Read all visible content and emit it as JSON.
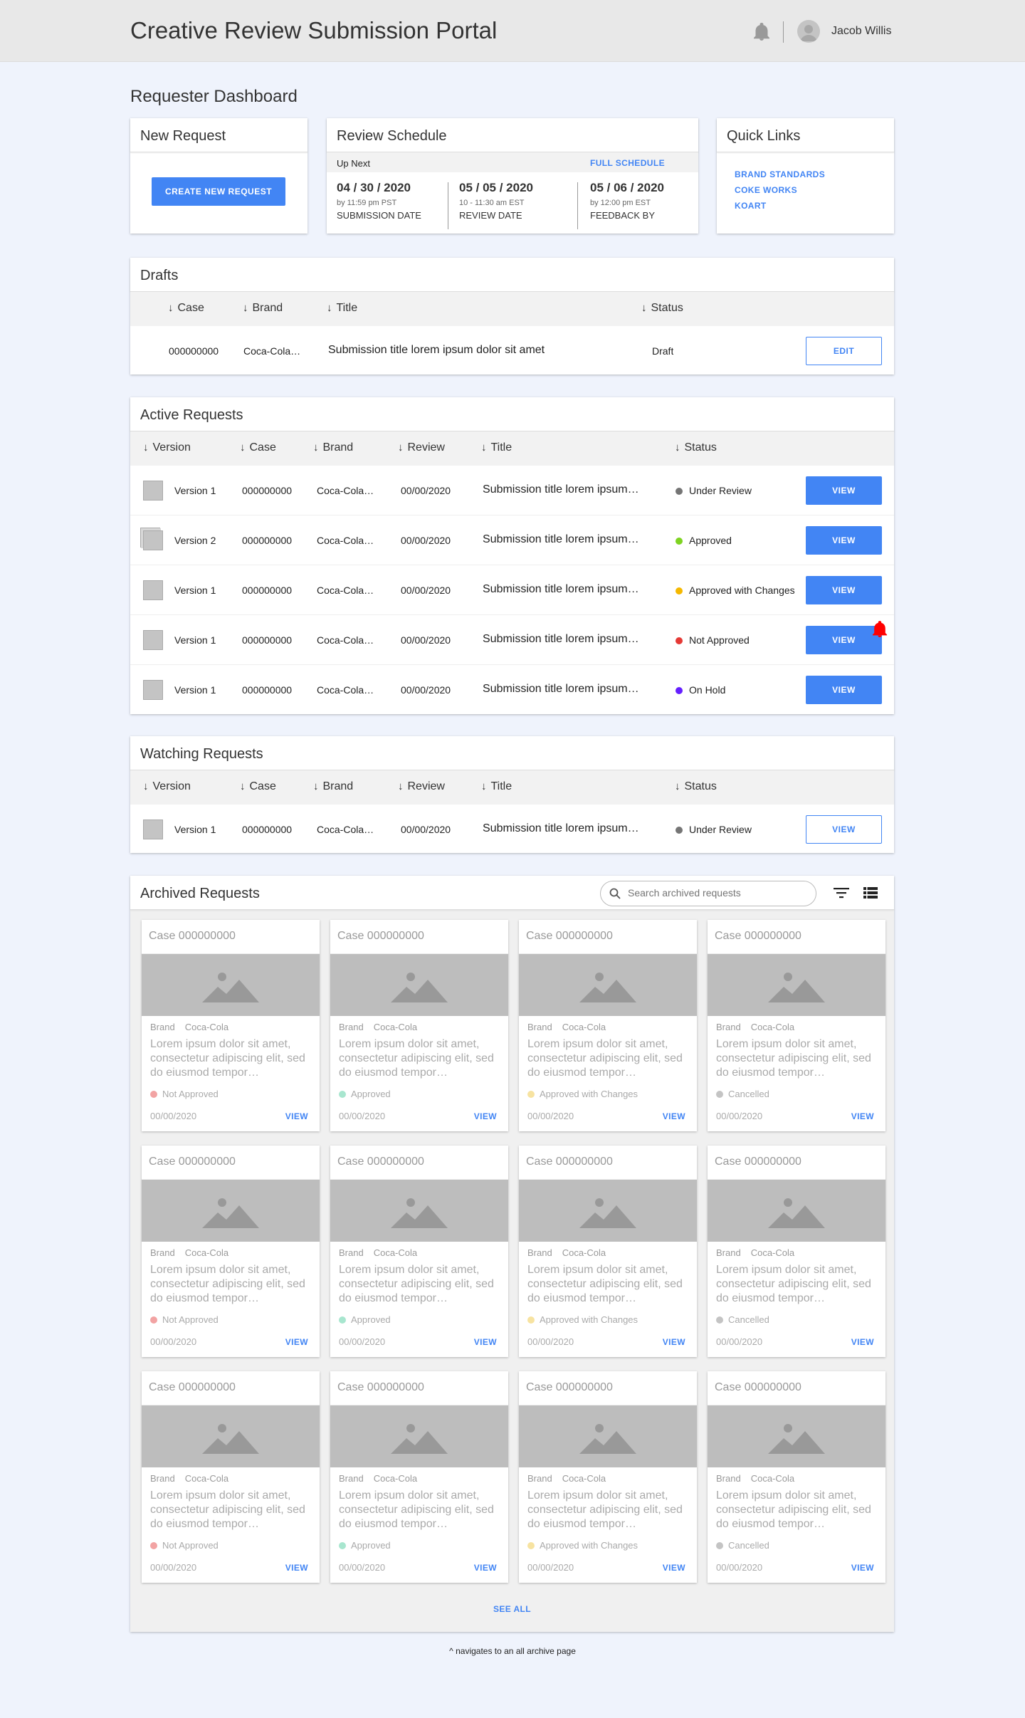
{
  "header": {
    "app_title": "Creative Review Submission Portal",
    "user_name": "Jacob Willis"
  },
  "page_title": "Requester Dashboard",
  "new_request": {
    "title": "New Request",
    "button_label": "CREATE NEW REQUEST"
  },
  "review_schedule": {
    "title": "Review Schedule",
    "up_next": "Up Next",
    "full_schedule_link": "FULL SCHEDULE",
    "items": [
      {
        "date": "04 / 30 / 2020",
        "sub": "by 11:59 pm PST",
        "label": "SUBMISSION DATE"
      },
      {
        "date": "05 / 05 / 2020",
        "sub": "10 - 11:30 am EST",
        "label": "REVIEW DATE"
      },
      {
        "date": "05 / 06 / 2020",
        "sub": "by 12:00 pm EST",
        "label": "FEEDBACK BY"
      }
    ]
  },
  "quick_links": {
    "title": "Quick Links",
    "links": [
      "BRAND STANDARDS",
      "COKE WORKS",
      "KOART"
    ]
  },
  "drafts": {
    "title": "Drafts",
    "columns": [
      "Case",
      "Brand",
      "Title",
      "Status"
    ],
    "rows": [
      {
        "case": "000000000",
        "brand": "Coca-Cola…",
        "title": "Submission title lorem ipsum dolor sit amet",
        "status": "Draft",
        "action": "EDIT"
      }
    ]
  },
  "active_requests": {
    "title": "Active Requests",
    "columns": [
      "Version",
      "Case",
      "Brand",
      "Review",
      "Title",
      "Status"
    ],
    "rows": [
      {
        "version": "Version 1",
        "case": "000000000",
        "brand": "Coca-Cola…",
        "review": "00/00/2020",
        "title": "Submission title lorem ipsum…",
        "status": "Under Review",
        "status_color": "#757575",
        "action": "VIEW"
      },
      {
        "version": "Version 2",
        "case": "000000000",
        "brand": "Coca-Cola…",
        "review": "00/00/2020",
        "title": "Submission title lorem ipsum…",
        "status": "Approved",
        "status_color": "#7ed321",
        "action": "VIEW"
      },
      {
        "version": "Version 1",
        "case": "000000000",
        "brand": "Coca-Cola…",
        "review": "00/00/2020",
        "title": "Submission title lorem ipsum…",
        "status": "Approved with Changes",
        "status_color": "#f5b800",
        "action": "VIEW"
      },
      {
        "version": "Version 1",
        "case": "000000000",
        "brand": "Coca-Cola…",
        "review": "00/00/2020",
        "title": "Submission title lorem ipsum…",
        "status": "Not Approved",
        "status_color": "#e53935",
        "action": "VIEW"
      },
      {
        "version": "Version 1",
        "case": "000000000",
        "brand": "Coca-Cola…",
        "review": "00/00/2020",
        "title": "Submission title lorem ipsum…",
        "status": "On Hold",
        "status_color": "#651fff",
        "action": "VIEW"
      }
    ]
  },
  "watching_requests": {
    "title": "Watching Requests",
    "columns": [
      "Version",
      "Case",
      "Brand",
      "Review",
      "Title",
      "Status"
    ],
    "rows": [
      {
        "version": "Version 1",
        "case": "000000000",
        "brand": "Coca-Cola…",
        "review": "00/00/2020",
        "title": "Submission title lorem ipsum…",
        "status": "Under Review",
        "status_color": "#757575",
        "action": "VIEW"
      }
    ]
  },
  "archived_requests": {
    "title": "Archived Requests",
    "search_placeholder": "Search archived requests",
    "brand_label": "Brand",
    "see_all": "SEE ALL",
    "cards": [
      {
        "case": "Case 000000000",
        "brand": "Coca-Cola",
        "desc": "Lorem ipsum dolor sit amet, consectetur adipiscing elit, sed do eiusmod tempor…",
        "status": "Not Approved",
        "status_color": "#f2a3a3",
        "date": "00/00/2020",
        "action": "VIEW"
      },
      {
        "case": "Case 000000000",
        "brand": "Coca-Cola",
        "desc": "Lorem ipsum dolor sit amet, consectetur adipiscing elit, sed do eiusmod tempor…",
        "status": "Approved",
        "status_color": "#a8e6cf",
        "date": "00/00/2020",
        "action": "VIEW"
      },
      {
        "case": "Case 000000000",
        "brand": "Coca-Cola",
        "desc": "Lorem ipsum dolor sit amet, consectetur adipiscing elit, sed do eiusmod tempor…",
        "status": "Approved with Changes",
        "status_color": "#f7e3a1",
        "date": "00/00/2020",
        "action": "VIEW"
      },
      {
        "case": "Case 000000000",
        "brand": "Coca-Cola",
        "desc": "Lorem ipsum dolor sit amet, consectetur adipiscing elit, sed do eiusmod tempor…",
        "status": "Cancelled",
        "status_color": "#c4c4c4",
        "date": "00/00/2020",
        "action": "VIEW"
      },
      {
        "case": "Case 000000000",
        "brand": "Coca-Cola",
        "desc": "Lorem ipsum dolor sit amet, consectetur adipiscing elit, sed do eiusmod tempor…",
        "status": "Not Approved",
        "status_color": "#f2a3a3",
        "date": "00/00/2020",
        "action": "VIEW"
      },
      {
        "case": "Case 000000000",
        "brand": "Coca-Cola",
        "desc": "Lorem ipsum dolor sit amet, consectetur adipiscing elit, sed do eiusmod tempor…",
        "status": "Approved",
        "status_color": "#a8e6cf",
        "date": "00/00/2020",
        "action": "VIEW"
      },
      {
        "case": "Case 000000000",
        "brand": "Coca-Cola",
        "desc": "Lorem ipsum dolor sit amet, consectetur adipiscing elit, sed do eiusmod tempor…",
        "status": "Approved with Changes",
        "status_color": "#f7e3a1",
        "date": "00/00/2020",
        "action": "VIEW"
      },
      {
        "case": "Case 000000000",
        "brand": "Coca-Cola",
        "desc": "Lorem ipsum dolor sit amet, consectetur adipiscing elit, sed do eiusmod tempor…",
        "status": "Cancelled",
        "status_color": "#c4c4c4",
        "date": "00/00/2020",
        "action": "VIEW"
      },
      {
        "case": "Case 000000000",
        "brand": "Coca-Cola",
        "desc": "Lorem ipsum dolor sit amet, consectetur adipiscing elit, sed do eiusmod tempor…",
        "status": "Not Approved",
        "status_color": "#f2a3a3",
        "date": "00/00/2020",
        "action": "VIEW"
      },
      {
        "case": "Case 000000000",
        "brand": "Coca-Cola",
        "desc": "Lorem ipsum dolor sit amet, consectetur adipiscing elit, sed do eiusmod tempor…",
        "status": "Approved",
        "status_color": "#a8e6cf",
        "date": "00/00/2020",
        "action": "VIEW"
      },
      {
        "case": "Case 000000000",
        "brand": "Coca-Cola",
        "desc": "Lorem ipsum dolor sit amet, consectetur adipiscing elit, sed do eiusmod tempor…",
        "status": "Approved with Changes",
        "status_color": "#f7e3a1",
        "date": "00/00/2020",
        "action": "VIEW"
      },
      {
        "case": "Case 000000000",
        "brand": "Coca-Cola",
        "desc": "Lorem ipsum dolor sit amet, consectetur adipiscing elit, sed do eiusmod tempor…",
        "status": "Cancelled",
        "status_color": "#c4c4c4",
        "date": "00/00/2020",
        "action": "VIEW"
      }
    ]
  },
  "footnote": "^ navigates to an all archive page",
  "colors": {
    "accent": "#4285f4",
    "page_bg": "#eff3fc",
    "header_bg": "#e8e8e8",
    "notification": "#ff0000"
  }
}
